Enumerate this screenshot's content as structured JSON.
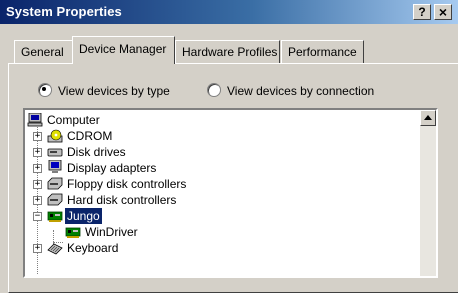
{
  "window": {
    "title": "System Properties",
    "help_button": "?",
    "close_button": "×"
  },
  "tabs": [
    {
      "label": "General",
      "active": false
    },
    {
      "label": "Device Manager",
      "active": true
    },
    {
      "label": "Hardware Profiles",
      "active": false
    },
    {
      "label": "Performance",
      "active": false
    }
  ],
  "view_options": {
    "by_type": {
      "label": "View devices by type",
      "selected": true
    },
    "by_connection": {
      "label": "View devices by connection",
      "selected": false
    }
  },
  "tree": {
    "root": {
      "label": "Computer",
      "icon": "computer-icon"
    },
    "items": [
      {
        "label": "CDROM",
        "icon": "cdrom-icon",
        "expander": "+"
      },
      {
        "label": "Disk drives",
        "icon": "disk-drive-icon",
        "expander": "+"
      },
      {
        "label": "Display adapters",
        "icon": "monitor-icon",
        "expander": "+"
      },
      {
        "label": "Floppy disk controllers",
        "icon": "controller-icon",
        "expander": "+"
      },
      {
        "label": "Hard disk controllers",
        "icon": "controller-icon",
        "expander": "+"
      },
      {
        "label": "Jungo",
        "icon": "board-icon",
        "expander": "−",
        "selected": true
      },
      {
        "label": "WinDriver",
        "icon": "board-icon",
        "child": true
      },
      {
        "label": "Keyboard",
        "icon": "keyboard-icon",
        "expander": "+"
      }
    ]
  },
  "colors": {
    "selection": "#0a246a",
    "title_gradient_start": "#0a246a",
    "title_gradient_end": "#a6caf0",
    "face": "#d4d0c8"
  }
}
